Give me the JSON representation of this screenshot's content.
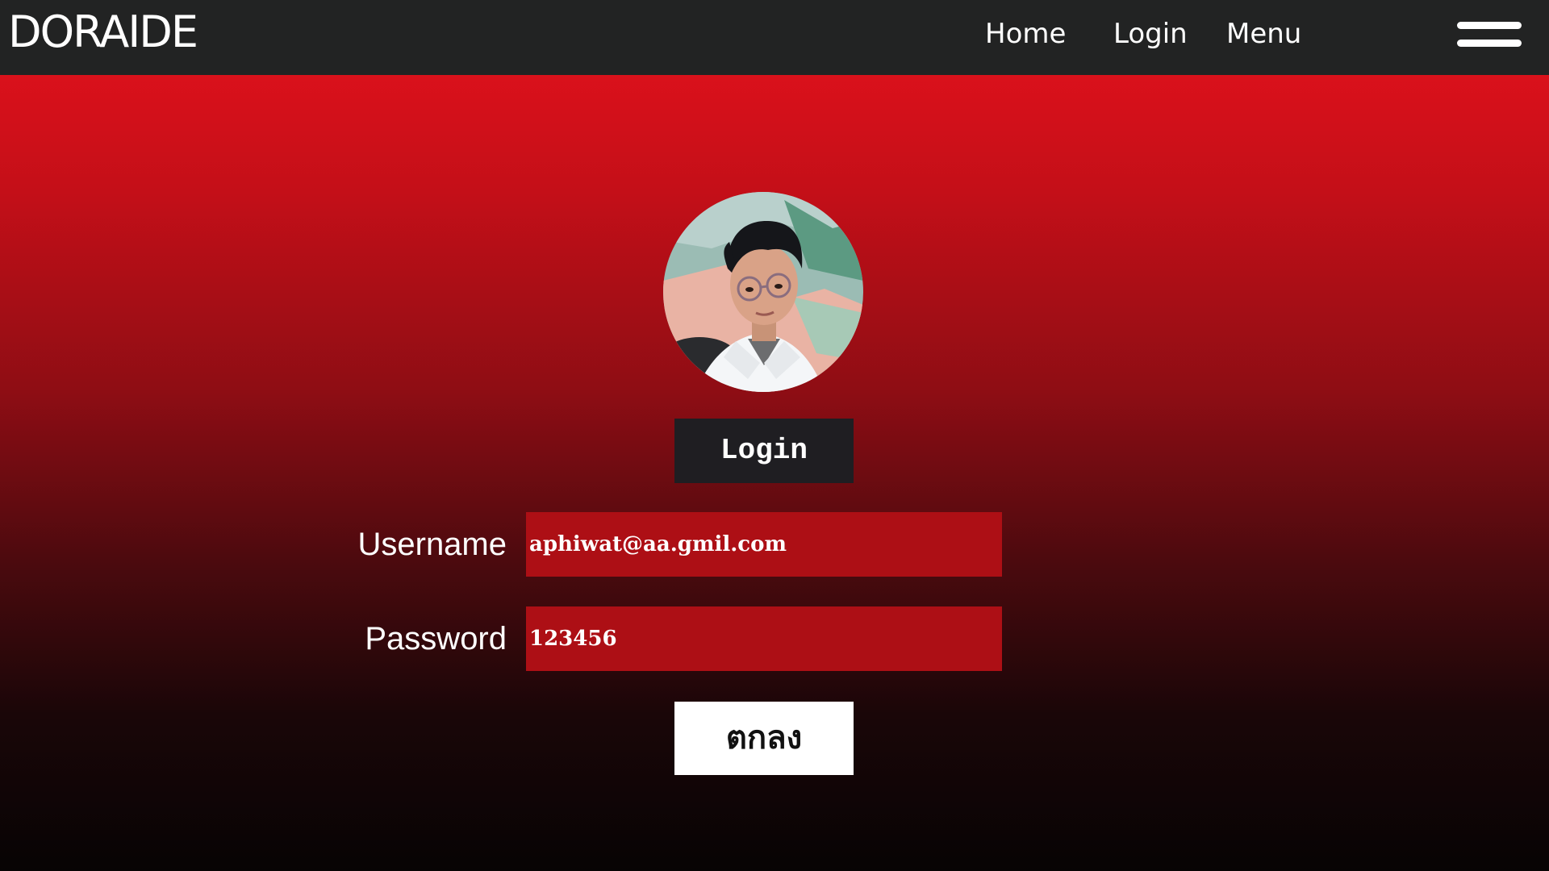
{
  "navbar": {
    "brand": "DORAIDE",
    "links": [
      {
        "label": "Home"
      },
      {
        "label": "Login"
      },
      {
        "label": "Menu"
      }
    ],
    "menu_icon": "hamburger-icon"
  },
  "profile": {
    "avatar_icon": "profile-avatar"
  },
  "form": {
    "heading": "Login",
    "username_label": "Username",
    "username_value": "aphiwat@aa.gmil.com",
    "password_label": "Password",
    "password_value": "123456",
    "submit_label": "ตกลง"
  },
  "colors": {
    "navbar_bg": "#222323",
    "gradient_top": "#e8121d",
    "gradient_bottom": "#070404",
    "input_bg": "#ad0f15",
    "heading_bg": "#1f1e22",
    "submit_bg": "#ffffff"
  }
}
